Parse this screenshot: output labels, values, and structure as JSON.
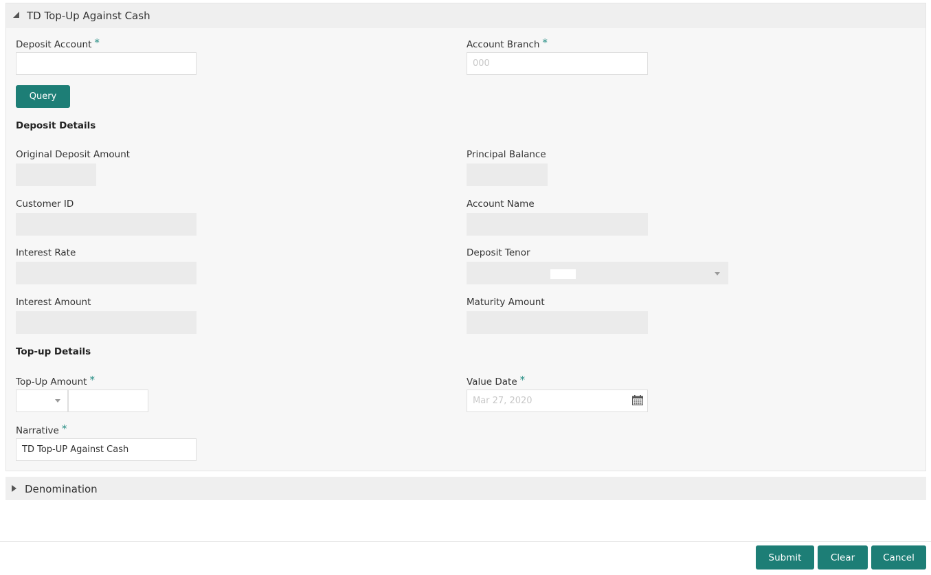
{
  "panel": {
    "title": "TD Top-Up Against Cash"
  },
  "fields": {
    "deposit_account": {
      "label": "Deposit Account",
      "value": ""
    },
    "account_branch": {
      "label": "Account Branch",
      "value": "000"
    },
    "query_label": "Query",
    "deposit_details_heading": "Deposit Details",
    "original_deposit_amount": {
      "label": "Original Deposit Amount",
      "value": ""
    },
    "principal_balance": {
      "label": "Principal Balance",
      "value": ""
    },
    "customer_id": {
      "label": "Customer ID",
      "value": ""
    },
    "account_name": {
      "label": "Account Name",
      "value": ""
    },
    "interest_rate": {
      "label": "Interest Rate",
      "value": ""
    },
    "deposit_tenor": {
      "label": "Deposit Tenor",
      "value": ""
    },
    "interest_amount": {
      "label": "Interest Amount",
      "value": ""
    },
    "maturity_amount": {
      "label": "Maturity Amount",
      "value": ""
    },
    "topup_details_heading": "Top-up Details",
    "topup_amount": {
      "label": "Top-Up Amount",
      "currency": "",
      "value": ""
    },
    "value_date": {
      "label": "Value Date",
      "value": "Mar 27, 2020"
    },
    "narrative": {
      "label": "Narrative",
      "value": "TD Top-UP Against Cash"
    }
  },
  "required_marker": "*",
  "denomination": {
    "title": "Denomination"
  },
  "footer": {
    "submit": "Submit",
    "clear": "Clear",
    "cancel": "Cancel"
  },
  "colors": {
    "accent": "#1d7e76",
    "required": "#2a8f86",
    "panel_bg": "#f7f7f7",
    "readonly_bg": "#ebebeb"
  },
  "icons": [
    "collapse-triangle-icon",
    "expand-triangle-icon",
    "dropdown-caret-icon",
    "calendar-icon"
  ]
}
